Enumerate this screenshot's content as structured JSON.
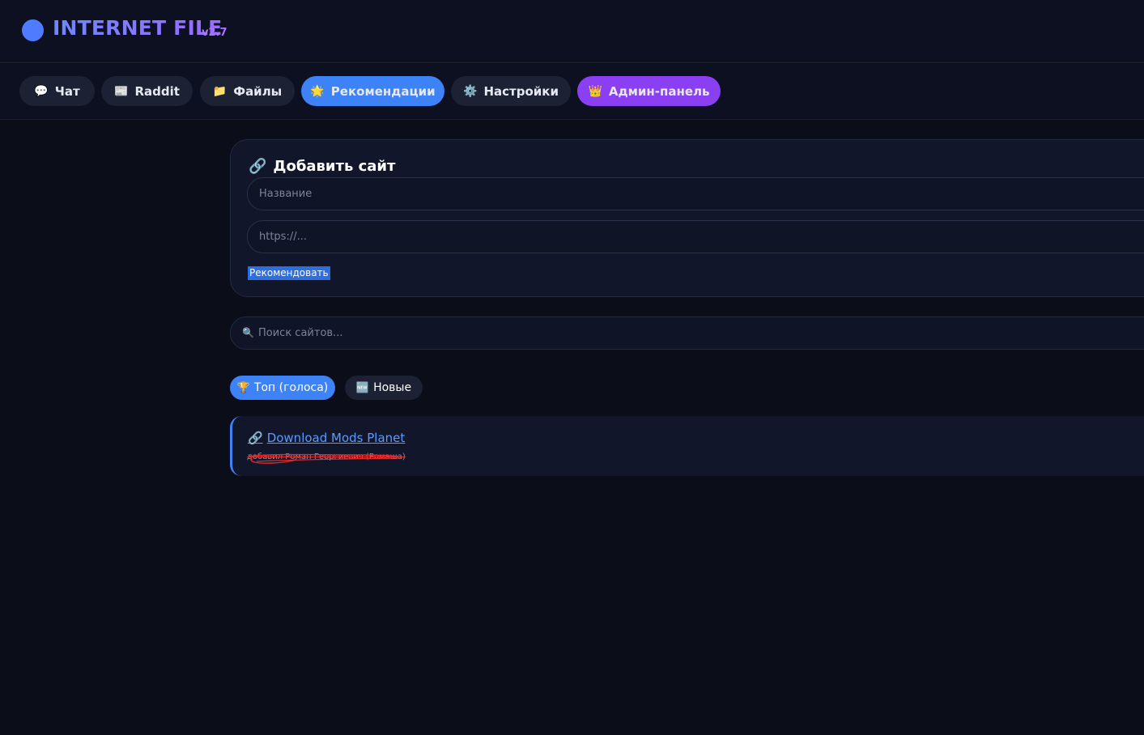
{
  "brand": {
    "title": "INTERNET FILE",
    "version": "v2.7",
    "accent": "#4f7cff"
  },
  "nav": {
    "items": [
      {
        "label": "Чат",
        "icon": "💬"
      },
      {
        "label": "Raddit",
        "icon": "📰"
      },
      {
        "label": "Файлы",
        "icon": "📁"
      },
      {
        "label": "Рекомендации",
        "icon": "🌟"
      },
      {
        "label": "Настройки",
        "icon": "⚙️"
      },
      {
        "label": "Админ-панель",
        "icon": "👑"
      }
    ],
    "active": "Рекомендации"
  },
  "add_site": {
    "icon": "🔗",
    "title": "Добавить сайт",
    "name_placeholder": "Название",
    "url_placeholder": "https://...",
    "submit_label": "Рекомендовать"
  },
  "search": {
    "icon": "🔍",
    "placeholder": "Поиск сайтов..."
  },
  "filters": [
    {
      "label": "Топ (голоса)",
      "icon": "🏆",
      "active": true
    },
    {
      "label": "Новые",
      "icon": "🆕",
      "active": false
    }
  ],
  "sites": [
    {
      "icon": "🔗",
      "name": "Download Mods Planet",
      "added_by": "добавил Роман Георгиевич (Ромаша)"
    }
  ],
  "colors": {
    "background": "#0b0d18",
    "active_tab": "#3d82f6",
    "admin_tab": "#8b3ff2",
    "link": "#5b9bff"
  }
}
